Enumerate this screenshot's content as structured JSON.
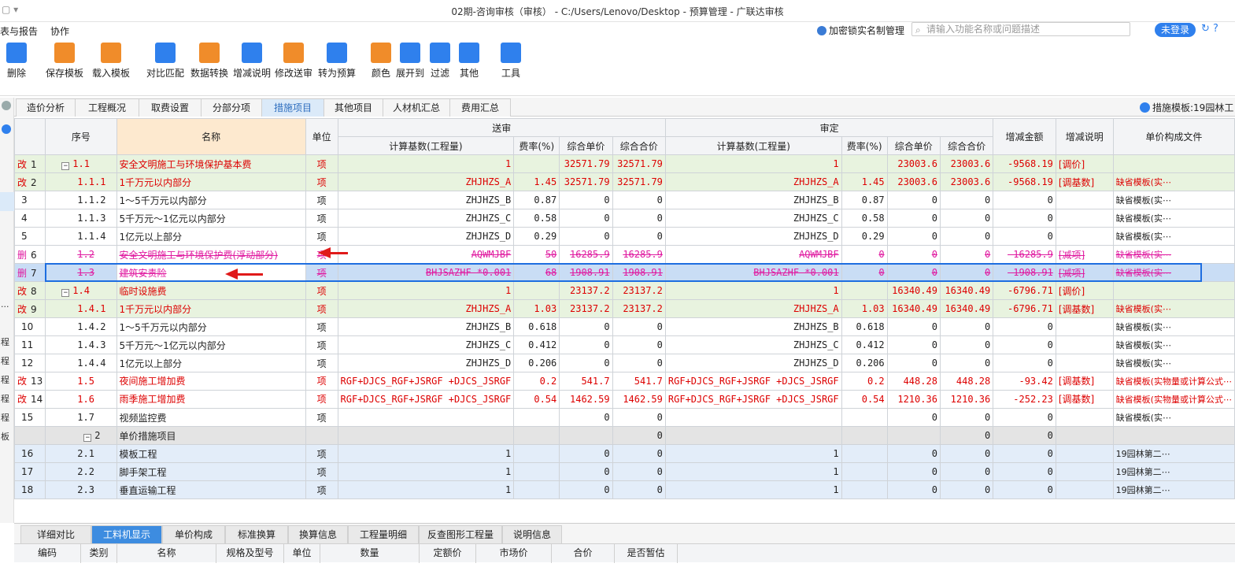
{
  "window": {
    "title": "02期-咨询审核（审核） - C:/Users/Lenovo/Desktop - 预算管理 - 广联达审核"
  },
  "menu": [
    "表与报告",
    "协作"
  ],
  "header_right": {
    "lock_label": "加密锁实名制管理",
    "search_placeholder": "请输入功能名称或问题描述",
    "login_label": "未登录"
  },
  "toolbar": [
    {
      "label": "删除",
      "icon": "trash-icon",
      "color": "#2f80ed"
    },
    {
      "label": "保存模板",
      "icon": "save-template-icon",
      "color": "#f08c2a"
    },
    {
      "label": "载入模板",
      "icon": "load-template-icon",
      "color": "#f08c2a"
    },
    {
      "label": "对比匹配",
      "icon": "compare-icon",
      "color": "#2f80ed"
    },
    {
      "label": "数据转换",
      "icon": "convert-icon",
      "color": "#f08c2a"
    },
    {
      "label": "增减说明",
      "icon": "note-icon",
      "color": "#2f80ed"
    },
    {
      "label": "修改送审",
      "icon": "edit-icon",
      "color": "#f08c2a"
    },
    {
      "label": "转为预算",
      "icon": "budget-icon",
      "color": "#2f80ed"
    },
    {
      "label": "颜色",
      "icon": "color-icon",
      "color": "#f08c2a"
    },
    {
      "label": "展开到",
      "icon": "expand-icon",
      "color": "#2f80ed"
    },
    {
      "label": "过滤",
      "icon": "filter-icon",
      "color": "#2f80ed"
    },
    {
      "label": "其他",
      "icon": "grid-icon",
      "color": "#2f80ed"
    },
    {
      "label": "工具",
      "icon": "tools-icon",
      "color": "#2f80ed"
    }
  ],
  "tabs": [
    "造价分析",
    "工程概况",
    "取费设置",
    "分部分项",
    "措施项目",
    "其他项目",
    "人材机汇总",
    "费用汇总"
  ],
  "active_tab": "措施项目",
  "template_label": "措施模板:19园林工",
  "left_strip": [
    "...",
    "程",
    "程",
    "程",
    "程",
    "程",
    "板"
  ],
  "table": {
    "headers": {
      "seq": "序号",
      "name": "名称",
      "unit": "单位",
      "submitted": "送审",
      "approved": "审定",
      "base": "计算基数(工程量)",
      "rate": "费率(%)",
      "unit_price": "综合单价",
      "total": "综合合价",
      "diff": "增减金额",
      "note": "增减说明",
      "file": "单价构成文件"
    },
    "rows": [
      {
        "flag": "改",
        "idx": "1",
        "tree": "−",
        "seq": "1.1",
        "name": "安全文明施工与环境保护基本费",
        "unit": "项",
        "sb": "1",
        "sr": "",
        "su": "32571.79",
        "st": "32571.79",
        "ab": "1",
        "ar": "",
        "au": "23003.6",
        "at": "23003.6",
        "diff": "-9568.19",
        "note": "[调价]",
        "file": "",
        "style": "green red"
      },
      {
        "flag": "改",
        "idx": "2",
        "tree": "",
        "seq": "1.1.1",
        "name": "1千万元以内部分",
        "unit": "项",
        "sb": "ZHJHZS_A",
        "sr": "1.45",
        "su": "32571.79",
        "st": "32571.79",
        "ab": "ZHJHZS_A",
        "ar": "1.45",
        "au": "23003.6",
        "at": "23003.6",
        "diff": "-9568.19",
        "note": "[调基数]",
        "file": "缺省模板(实⋯",
        "style": "green red"
      },
      {
        "flag": "",
        "idx": "3",
        "tree": "",
        "seq": "1.1.2",
        "name": "1～5千万元以内部分",
        "unit": "项",
        "sb": "ZHJHZS_B",
        "sr": "0.87",
        "su": "0",
        "st": "0",
        "ab": "ZHJHZS_B",
        "ar": "0.87",
        "au": "0",
        "at": "0",
        "diff": "0",
        "note": "",
        "file": "缺省模板(实⋯",
        "style": "white"
      },
      {
        "flag": "",
        "idx": "4",
        "tree": "",
        "seq": "1.1.3",
        "name": "5千万元～1亿元以内部分",
        "unit": "项",
        "sb": "ZHJHZS_C",
        "sr": "0.58",
        "su": "0",
        "st": "0",
        "ab": "ZHJHZS_C",
        "ar": "0.58",
        "au": "0",
        "at": "0",
        "diff": "0",
        "note": "",
        "file": "缺省模板(实⋯",
        "style": "white"
      },
      {
        "flag": "",
        "idx": "5",
        "tree": "",
        "seq": "1.1.4",
        "name": "1亿元以上部分",
        "unit": "项",
        "sb": "ZHJHZS_D",
        "sr": "0.29",
        "su": "0",
        "st": "0",
        "ab": "ZHJHZS_D",
        "ar": "0.29",
        "au": "0",
        "at": "0",
        "diff": "0",
        "note": "",
        "file": "缺省模板(实⋯",
        "style": "white"
      },
      {
        "flag": "删",
        "idx": "6",
        "tree": "",
        "seq": "1.2",
        "name": "安全文明施工与环境保护费(浮动部分)",
        "unit": "项",
        "sb": "AQWMJBF",
        "sr": "50",
        "su": "16285.9",
        "st": "16285.9",
        "ab": "AQWMJBF",
        "ar": "0",
        "au": "0",
        "at": "0",
        "diff": "-16285.9",
        "note": "[减项]",
        "file": "缺省模板(实⋯",
        "style": "pink"
      },
      {
        "flag": "删",
        "idx": "7",
        "tree": "",
        "seq": "1.3",
        "name": "建筑安责险",
        "unit": "项",
        "sb": "BHJSAZHF *0.001",
        "sr": "68",
        "su": "1908.91",
        "st": "1908.91",
        "ab": "BHJSAZHF *0.001",
        "ar": "0",
        "au": "0",
        "at": "0",
        "diff": "-1908.91",
        "note": "[减项]",
        "file": "缺省模板(实⋯",
        "style": "pink sel"
      },
      {
        "flag": "改",
        "idx": "8",
        "tree": "−",
        "seq": "1.4",
        "name": "临时设施费",
        "unit": "项",
        "sb": "1",
        "sr": "",
        "su": "23137.2",
        "st": "23137.2",
        "ab": "1",
        "ar": "",
        "au": "16340.49",
        "at": "16340.49",
        "diff": "-6796.71",
        "note": "[调价]",
        "file": "",
        "style": "green red"
      },
      {
        "flag": "改",
        "idx": "9",
        "tree": "",
        "seq": "1.4.1",
        "name": "1千万元以内部分",
        "unit": "项",
        "sb": "ZHJHZS_A",
        "sr": "1.03",
        "su": "23137.2",
        "st": "23137.2",
        "ab": "ZHJHZS_A",
        "ar": "1.03",
        "au": "16340.49",
        "at": "16340.49",
        "diff": "-6796.71",
        "note": "[调基数]",
        "file": "缺省模板(实⋯",
        "style": "green red"
      },
      {
        "flag": "",
        "idx": "10",
        "tree": "",
        "seq": "1.4.2",
        "name": "1～5千万元以内部分",
        "unit": "项",
        "sb": "ZHJHZS_B",
        "sr": "0.618",
        "su": "0",
        "st": "0",
        "ab": "ZHJHZS_B",
        "ar": "0.618",
        "au": "0",
        "at": "0",
        "diff": "0",
        "note": "",
        "file": "缺省模板(实⋯",
        "style": "white"
      },
      {
        "flag": "",
        "idx": "11",
        "tree": "",
        "seq": "1.4.3",
        "name": "5千万元～1亿元以内部分",
        "unit": "项",
        "sb": "ZHJHZS_C",
        "sr": "0.412",
        "su": "0",
        "st": "0",
        "ab": "ZHJHZS_C",
        "ar": "0.412",
        "au": "0",
        "at": "0",
        "diff": "0",
        "note": "",
        "file": "缺省模板(实⋯",
        "style": "white"
      },
      {
        "flag": "",
        "idx": "12",
        "tree": "",
        "seq": "1.4.4",
        "name": "1亿元以上部分",
        "unit": "项",
        "sb": "ZHJHZS_D",
        "sr": "0.206",
        "su": "0",
        "st": "0",
        "ab": "ZHJHZS_D",
        "ar": "0.206",
        "au": "0",
        "at": "0",
        "diff": "0",
        "note": "",
        "file": "缺省模板(实⋯",
        "style": "white"
      },
      {
        "flag": "改",
        "idx": "13",
        "tree": "",
        "seq": "1.5",
        "name": "夜间施工增加费",
        "unit": "项",
        "sb": "RGF+DJCS_RGF+JSRGF +DJCS_JSRGF",
        "sr": "0.2",
        "su": "541.7",
        "st": "541.7",
        "ab": "RGF+DJCS_RGF+JSRGF +DJCS_JSRGF",
        "ar": "0.2",
        "au": "448.28",
        "at": "448.28",
        "diff": "-93.42",
        "note": "[调基数]",
        "file": "缺省模板(实物量或计算公式⋯",
        "style": "white red tall"
      },
      {
        "flag": "改",
        "idx": "14",
        "tree": "",
        "seq": "1.6",
        "name": "雨季施工增加费",
        "unit": "项",
        "sb": "RGF+DJCS_RGF+JSRGF +DJCS_JSRGF",
        "sr": "0.54",
        "su": "1462.59",
        "st": "1462.59",
        "ab": "RGF+DJCS_RGF+JSRGF +DJCS_JSRGF",
        "ar": "0.54",
        "au": "1210.36",
        "at": "1210.36",
        "diff": "-252.23",
        "note": "[调基数]",
        "file": "缺省模板(实物量或计算公式⋯",
        "style": "white red tall"
      },
      {
        "flag": "",
        "idx": "15",
        "tree": "",
        "seq": "1.7",
        "name": "视频监控费",
        "unit": "项",
        "sb": "",
        "sr": "",
        "su": "0",
        "st": "0",
        "ab": "",
        "ar": "",
        "au": "0",
        "at": "0",
        "diff": "0",
        "note": "",
        "file": "缺省模板(实⋯",
        "style": "white"
      },
      {
        "flag": "",
        "idx": "",
        "tree": "−",
        "seq": "2",
        "name": "单价措施项目",
        "unit": "",
        "sb": "",
        "sr": "",
        "su": "",
        "st": "0",
        "ab": "",
        "ar": "",
        "au": "",
        "at": "0",
        "diff": "0",
        "note": "",
        "file": "",
        "style": "gray"
      },
      {
        "flag": "",
        "idx": "16",
        "tree": "",
        "seq": "2.1",
        "name": "模板工程",
        "unit": "项",
        "sb": "1",
        "sr": "",
        "su": "0",
        "st": "0",
        "ab": "1",
        "ar": "",
        "au": "0",
        "at": "0",
        "diff": "0",
        "note": "",
        "file": "19园林第二⋯",
        "style": "blue"
      },
      {
        "flag": "",
        "idx": "17",
        "tree": "",
        "seq": "2.2",
        "name": "脚手架工程",
        "unit": "项",
        "sb": "1",
        "sr": "",
        "su": "0",
        "st": "0",
        "ab": "1",
        "ar": "",
        "au": "0",
        "at": "0",
        "diff": "0",
        "note": "",
        "file": "19园林第二⋯",
        "style": "blue"
      },
      {
        "flag": "",
        "idx": "18",
        "tree": "",
        "seq": "2.3",
        "name": "垂直运输工程",
        "unit": "项",
        "sb": "1",
        "sr": "",
        "su": "0",
        "st": "0",
        "ab": "1",
        "ar": "",
        "au": "0",
        "at": "0",
        "diff": "0",
        "note": "",
        "file": "19园林第二⋯",
        "style": "blue"
      }
    ]
  },
  "bottom_tabs": [
    "详细对比",
    "工料机显示",
    "单价构成",
    "标准换算",
    "换算信息",
    "工程量明细",
    "反查图形工程量",
    "说明信息"
  ],
  "active_bottom_tab": "工料机显示",
  "bottom_headers": [
    "编码",
    "类别",
    "名称",
    "规格及型号",
    "单位",
    "数量",
    "定额价",
    "市场价",
    "合价",
    "是否暂估"
  ]
}
